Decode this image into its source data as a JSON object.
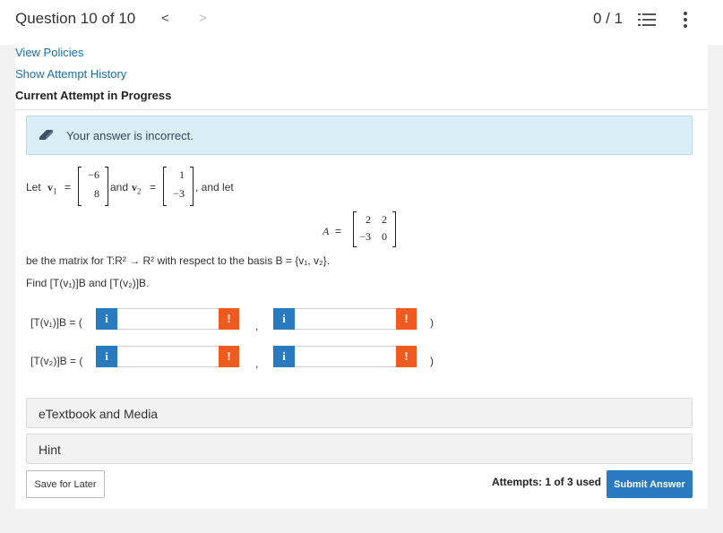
{
  "header": {
    "question_label": "Question 10 of 10",
    "prev_glyph": "<",
    "next_glyph": ">",
    "score": "0 / 1"
  },
  "links": {
    "view_policies": "View Policies",
    "show_attempt_history": "Show Attempt History"
  },
  "attempt_status": "Current Attempt in Progress",
  "alert": {
    "text": "Your answer is incorrect.",
    "background": "#daeef7"
  },
  "problem": {
    "let": "Let",
    "v1_symbol": "v",
    "v1_sub": "1",
    "equals": "=",
    "v1_values": [
      "−6",
      "8"
    ],
    "and": "and",
    "v2_symbol": "v",
    "v2_sub": "2",
    "v2_values": [
      "1",
      "−3"
    ],
    "and_let": ", and let",
    "matrix_symbol": "A",
    "matrix_rows": [
      [
        "2",
        "2"
      ],
      [
        "−3",
        "0"
      ]
    ],
    "statement": "be the matrix for T:R² → R² with respect to the basis B = {v₁, v₂}.",
    "prompt": "Find [T(v₁)]B and [T(v₂)]B."
  },
  "answers": {
    "row1_label": "[T(v₁)]B = (",
    "row2_label": "[T(v₂)]B = (",
    "comma": ",",
    "close_paren": ")",
    "info_glyph": "i",
    "error_glyph": "!",
    "values": [
      "",
      "",
      "",
      ""
    ]
  },
  "panels": {
    "etextbook": "eTextbook and Media",
    "hint": "Hint"
  },
  "footer": {
    "save_label": "Save for Later",
    "attempts": "Attempts: 1 of 3 used",
    "submit_label": "Submit Answer"
  },
  "colors": {
    "accent": "#2a7ac0",
    "error": "#ee5a1f",
    "link": "#1a6fb3"
  },
  "icons": [
    "list-icon",
    "more-vertical-icon",
    "eraser-icon",
    "info-icon",
    "error-icon"
  ]
}
